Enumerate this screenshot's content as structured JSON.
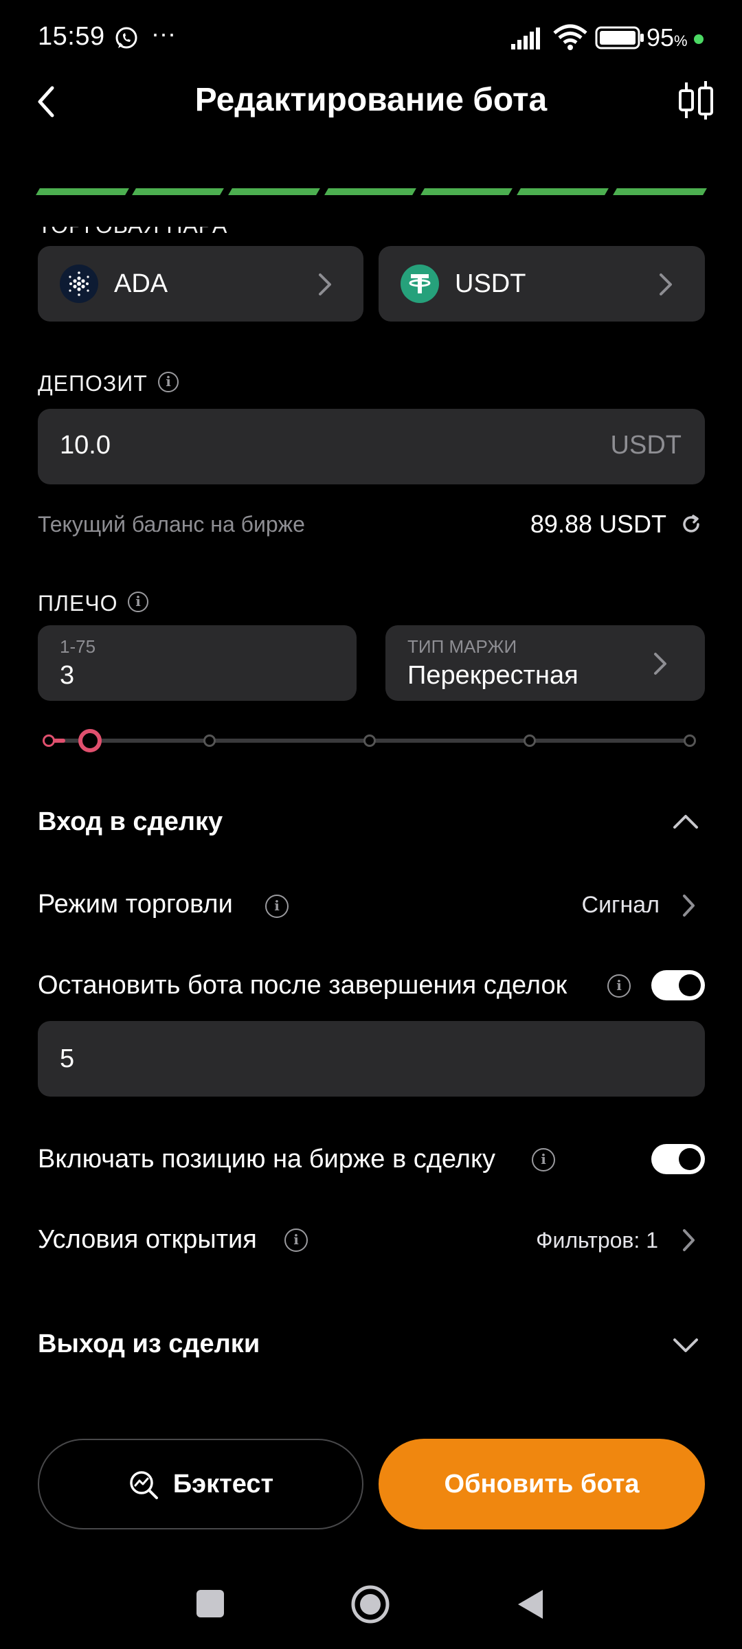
{
  "status_bar": {
    "time": "15:59",
    "dots": "···",
    "battery_percent": "95",
    "battery_unit": "%"
  },
  "header": {
    "title": "Редактирование бота",
    "progress_segments": 7
  },
  "trading_pair": {
    "label": "ТОРГОВАЯ ПАРА",
    "base": "ADA",
    "quote": "USDT"
  },
  "deposit": {
    "label": "ДЕПОЗИТ",
    "value": "10.0",
    "unit": "USDT",
    "balance_label": "Текущий баланс на бирже",
    "balance_value": "89.88 USDT"
  },
  "leverage": {
    "label": "ПЛЕЧО",
    "range_hint": "1-75",
    "value": "3",
    "margin_label": "ТИП МАРЖИ",
    "margin_value": "Перекрестная",
    "slider_fraction": 0.027
  },
  "entry": {
    "title": "Вход в сделку",
    "trade_mode_label": "Режим торговли",
    "trade_mode_value": "Сигнал",
    "stop_after_label": "Остановить бота после завершения сделок",
    "stop_after_enabled": true,
    "stop_after_value": "5",
    "include_position_label": "Включать позицию на бирже в сделку",
    "include_position_enabled": true,
    "open_conditions_label": "Условия открытия",
    "open_conditions_value": "Фильтров: 1"
  },
  "exit": {
    "title": "Выход из сделки"
  },
  "actions": {
    "backtest_label": "Бэктест",
    "update_label": "Обновить бота"
  },
  "colors": {
    "accent_orange": "#f0870f",
    "progress_green": "#4caf50",
    "slider_pink": "#e0506e",
    "card_bg": "#2a2a2c",
    "tether_green": "#26a17b"
  }
}
